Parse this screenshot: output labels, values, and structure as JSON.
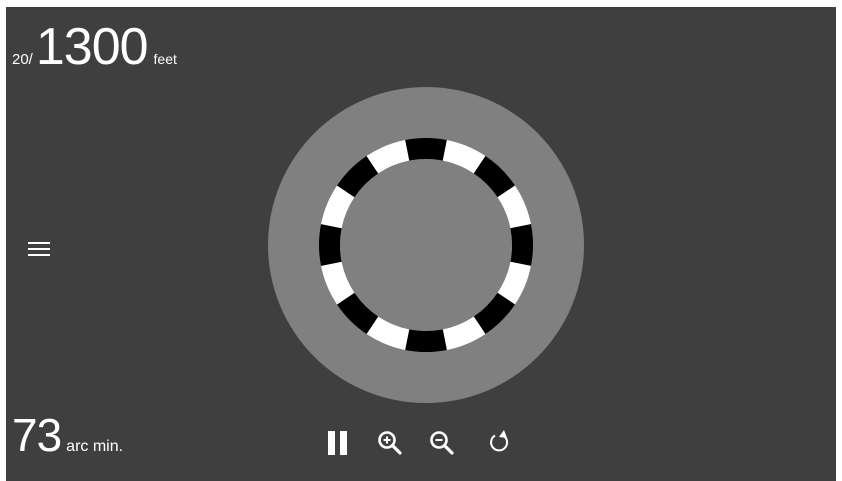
{
  "acuity": {
    "prefix": "20/",
    "value": "1300",
    "unit": "feet"
  },
  "arc": {
    "value": "73",
    "unit": "arc min."
  },
  "target": {
    "segments": 16,
    "outer_fill": "#808080",
    "ring_colors": [
      "#000000",
      "#ffffff"
    ]
  },
  "controls": {
    "icons": [
      "pause-icon",
      "zoom-in-icon",
      "zoom-out-icon",
      "refresh-icon"
    ]
  },
  "menu": {
    "icon": "hamburger-menu-icon"
  },
  "colors": {
    "background": "#3f3f3f",
    "text": "#ffffff"
  }
}
